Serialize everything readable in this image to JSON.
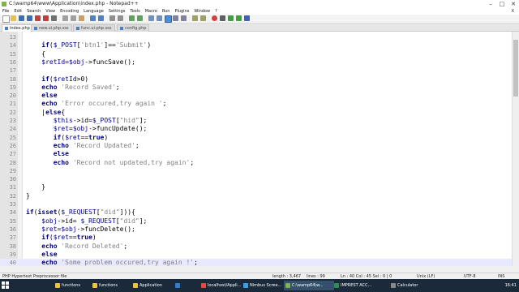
{
  "window": {
    "title": "C:\\wamp64\\www\\Application\\index.php - Notepad++",
    "controls": [
      "–",
      "□",
      "✕"
    ]
  },
  "menu": [
    "File",
    "Edit",
    "Search",
    "View",
    "Encoding",
    "Language",
    "Settings",
    "Tools",
    "Macro",
    "Run",
    "Plugins",
    "Window",
    "?"
  ],
  "menu_close": "X",
  "tabs": [
    {
      "label": "index.php",
      "active": true
    },
    {
      "label": "new.ui.php.sss",
      "active": false
    },
    {
      "label": "func.ui.php.sss",
      "active": false
    },
    {
      "label": "config.php",
      "active": false
    }
  ],
  "editor": {
    "lines": [
      {
        "num": "13",
        "tokens": [
          [
            "tx",
            ""
          ]
        ]
      },
      {
        "num": "14",
        "tokens": [
          [
            "tx",
            "    "
          ],
          [
            "kw",
            "if"
          ],
          [
            "tx",
            "("
          ],
          [
            "var",
            "$_POST"
          ],
          [
            "tx",
            "["
          ],
          [
            "str",
            "'btn1'"
          ],
          [
            "tx",
            "]=="
          ],
          [
            "str",
            "'Submit'"
          ],
          [
            "tx",
            ")"
          ]
        ]
      },
      {
        "num": "15",
        "tokens": [
          [
            "tx",
            "    {"
          ]
        ]
      },
      {
        "num": "16",
        "tokens": [
          [
            "tx",
            "    "
          ],
          [
            "var",
            "$retId"
          ],
          [
            "tx",
            "="
          ],
          [
            "var",
            "$obj"
          ],
          [
            "tx",
            "->funcSave();"
          ]
        ]
      },
      {
        "num": "17",
        "tokens": [
          [
            "tx",
            ""
          ]
        ]
      },
      {
        "num": "18",
        "tokens": [
          [
            "tx",
            "    "
          ],
          [
            "kw",
            "if"
          ],
          [
            "tx",
            "("
          ],
          [
            "var",
            "$retId"
          ],
          [
            "tx",
            ">0)"
          ]
        ]
      },
      {
        "num": "19",
        "tokens": [
          [
            "tx",
            "    "
          ],
          [
            "kw",
            "echo"
          ],
          [
            "tx",
            " "
          ],
          [
            "str",
            "'Record Saved'"
          ],
          [
            "tx",
            ";"
          ]
        ]
      },
      {
        "num": "20",
        "tokens": [
          [
            "tx",
            "    "
          ],
          [
            "kw",
            "else"
          ]
        ]
      },
      {
        "num": "21",
        "tokens": [
          [
            "tx",
            "    "
          ],
          [
            "kw",
            "echo"
          ],
          [
            "tx",
            " "
          ],
          [
            "str",
            "'Error occured,try again '"
          ],
          [
            "tx",
            ";"
          ]
        ]
      },
      {
        "num": "22",
        "tokens": [
          [
            "tx",
            "    |"
          ],
          [
            "kw",
            "else"
          ],
          [
            "tx",
            "{"
          ]
        ]
      },
      {
        "num": "23",
        "tokens": [
          [
            "tx",
            "       "
          ],
          [
            "var",
            "$this"
          ],
          [
            "tx",
            "->id="
          ],
          [
            "var",
            "$_POST"
          ],
          [
            "tx",
            "["
          ],
          [
            "str",
            "\"hid\""
          ],
          [
            "tx",
            "];"
          ]
        ]
      },
      {
        "num": "24",
        "tokens": [
          [
            "tx",
            "       "
          ],
          [
            "var",
            "$ret"
          ],
          [
            "tx",
            "="
          ],
          [
            "var",
            "$obj"
          ],
          [
            "tx",
            "->funcUpdate();"
          ]
        ]
      },
      {
        "num": "25",
        "tokens": [
          [
            "tx",
            "       "
          ],
          [
            "kw",
            "if"
          ],
          [
            "tx",
            "("
          ],
          [
            "var",
            "$ret"
          ],
          [
            "tx",
            "=="
          ],
          [
            "kw",
            "true"
          ],
          [
            "tx",
            ")"
          ]
        ]
      },
      {
        "num": "26",
        "tokens": [
          [
            "tx",
            "       "
          ],
          [
            "kw",
            "echo"
          ],
          [
            "tx",
            " "
          ],
          [
            "str",
            "'Record Updated'"
          ],
          [
            "tx",
            ";"
          ]
        ]
      },
      {
        "num": "27",
        "tokens": [
          [
            "tx",
            "       "
          ],
          [
            "kw",
            "else"
          ]
        ]
      },
      {
        "num": "28",
        "tokens": [
          [
            "tx",
            "       "
          ],
          [
            "kw",
            "echo"
          ],
          [
            "tx",
            " "
          ],
          [
            "str",
            "'Record not updated,try again'"
          ],
          [
            "tx",
            ";"
          ]
        ]
      },
      {
        "num": "29",
        "tokens": [
          [
            "tx",
            ""
          ]
        ]
      },
      {
        "num": "30",
        "tokens": [
          [
            "tx",
            ""
          ]
        ]
      },
      {
        "num": "31",
        "tokens": [
          [
            "tx",
            "    }"
          ]
        ]
      },
      {
        "num": "32",
        "tokens": [
          [
            "tx",
            "}"
          ]
        ]
      },
      {
        "num": "33",
        "tokens": [
          [
            "tx",
            ""
          ]
        ]
      },
      {
        "num": "34",
        "tokens": [
          [
            "kw",
            "if"
          ],
          [
            "tx",
            "("
          ],
          [
            "kw",
            "isset"
          ],
          [
            "tx",
            "("
          ],
          [
            "var",
            "$_REQUEST"
          ],
          [
            "tx",
            "["
          ],
          [
            "str",
            "\"did\""
          ],
          [
            "tx",
            "])){"
          ]
        ]
      },
      {
        "num": "35",
        "tokens": [
          [
            "tx",
            "    "
          ],
          [
            "var",
            "$obj"
          ],
          [
            "tx",
            "->id= "
          ],
          [
            "var",
            "$_REQUEST"
          ],
          [
            "tx",
            "["
          ],
          [
            "str",
            "\"did\""
          ],
          [
            "tx",
            "];"
          ]
        ]
      },
      {
        "num": "36",
        "tokens": [
          [
            "tx",
            "    "
          ],
          [
            "var",
            "$ret"
          ],
          [
            "tx",
            "="
          ],
          [
            "var",
            "$obj"
          ],
          [
            "tx",
            "->funcDelete();"
          ]
        ]
      },
      {
        "num": "37",
        "tokens": [
          [
            "tx",
            "    "
          ],
          [
            "kw",
            "if"
          ],
          [
            "tx",
            "("
          ],
          [
            "var",
            "$ret"
          ],
          [
            "tx",
            "=="
          ],
          [
            "kw",
            "true"
          ],
          [
            "tx",
            ")"
          ]
        ]
      },
      {
        "num": "38",
        "tokens": [
          [
            "tx",
            "    "
          ],
          [
            "kw",
            "echo"
          ],
          [
            "tx",
            " "
          ],
          [
            "str",
            "'Record Deleted'"
          ],
          [
            "tx",
            ";"
          ]
        ]
      },
      {
        "num": "39",
        "tokens": [
          [
            "tx",
            "    "
          ],
          [
            "kw",
            "else"
          ]
        ]
      },
      {
        "num": "40",
        "tokens": [
          [
            "tx",
            "    "
          ],
          [
            "kw",
            "echo"
          ],
          [
            "tx",
            " "
          ],
          [
            "str",
            "'Some problem occured,try again !'"
          ],
          [
            "tx",
            ";"
          ]
        ],
        "highlight": true
      }
    ]
  },
  "status": {
    "filetype": "PHP Hypertext Preprocessor file",
    "length": "length : 3,467",
    "lines": "lines : 99",
    "position": "Ln : 40   Col : 45   Sel : 0 | 0",
    "eol": "Unix (LF)",
    "encoding": "UTF-8",
    "mode": "INS"
  },
  "taskbar": {
    "items": [
      {
        "label": "functions",
        "color": "#f0c040"
      },
      {
        "label": "functions",
        "color": "#f0c040"
      },
      {
        "label": "Application",
        "color": "#f0c040"
      },
      {
        "label": "",
        "color": "#2d7dd2"
      },
      {
        "label": "localhost/Appli...",
        "color": "#e84a3a"
      },
      {
        "label": "Nimbus Scree...",
        "color": "#3aa0e8"
      },
      {
        "label": "C:\\wamp64\\w...",
        "color": "#7fb34a",
        "active": true
      },
      {
        "label": "IMPREST ACC...",
        "color": "#2e8b57"
      },
      {
        "label": "Calculator",
        "color": "#555555"
      }
    ],
    "clock": "16:41"
  },
  "colors": {
    "keyword": "#000080",
    "string": "#808080",
    "variable": "#00008b",
    "highlight": "#e8e8ff",
    "taskbar": "#1b2a3a"
  }
}
